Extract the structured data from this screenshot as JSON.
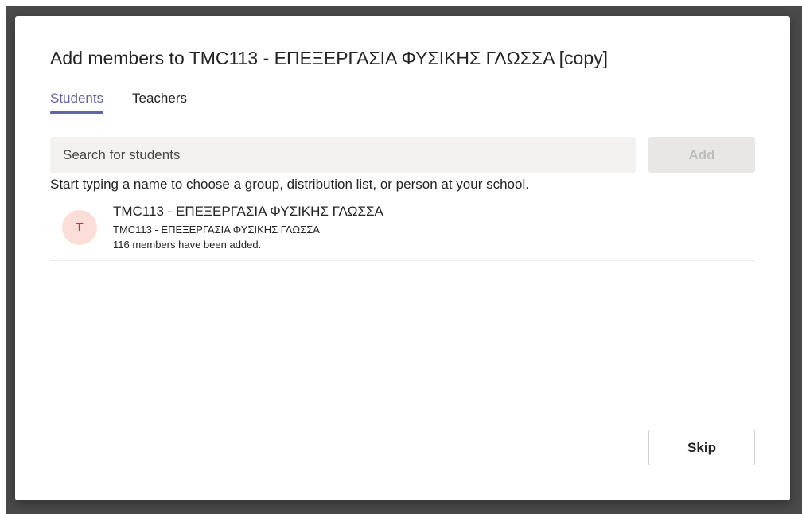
{
  "dialog": {
    "title": "Add members to TMC113 - ΕΠΕΞΕΡΓΑΣΙΑ ΦΥΣΙΚΗΣ ΓΛΩΣΣΑ [copy]"
  },
  "tabs": [
    {
      "label": "Students",
      "selected": true
    },
    {
      "label": "Teachers",
      "selected": false
    }
  ],
  "search": {
    "value": "",
    "placeholder": "Search for students"
  },
  "add_button": {
    "label": "Add",
    "enabled": false
  },
  "helper_text": "Start typing a name to choose a group, distribution list, or person at your school.",
  "members": [
    {
      "initial": "T",
      "name": "TMC113 - ΕΠΕΞΕΡΓΑΣΙΑ ΦΥΣΙΚΗΣ ΓΛΩΣΣΑ",
      "subtitle": "TMC113 - ΕΠΕΞΕΡΓΑΣΙΑ ΦΥΣΙΚΗΣ ΓΛΩΣΣΑ",
      "status": "116 members have been added."
    }
  ],
  "skip_button": {
    "label": "Skip"
  },
  "colors": {
    "accent": "#6264a7",
    "avatar_bg": "#fbded8",
    "avatar_text": "#c4314b",
    "backdrop": "#4a4a4a"
  }
}
